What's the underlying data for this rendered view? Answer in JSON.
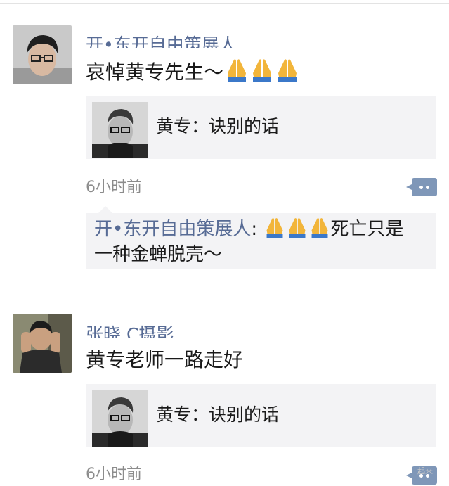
{
  "feed": {
    "posts": [
      {
        "author": "开•东开自由策展人",
        "text": "哀悼黄专先生～",
        "emoji_count": 3,
        "emoji_icon": "folded-hands-icon",
        "link": {
          "title": "黄专：诀别的话"
        },
        "time": "6小时前",
        "comments": [
          {
            "author": "开•东开自由策展人",
            "separator": ": ",
            "line1_text": "死亡只是",
            "line2_text": "一种金蝉脱壳～",
            "emoji_count": 3
          }
        ]
      },
      {
        "author": "张晓 C摄影",
        "text": "黄专老师一路走好",
        "link": {
          "title": "黄专：诀别的话"
        },
        "time": "6小时前"
      }
    ]
  },
  "watermark": "起来",
  "colors": {
    "nickname": "#576b95",
    "card_bg": "#f3f3f5",
    "comment_button": "#7f97b8",
    "emoji": "#f2b53a"
  }
}
